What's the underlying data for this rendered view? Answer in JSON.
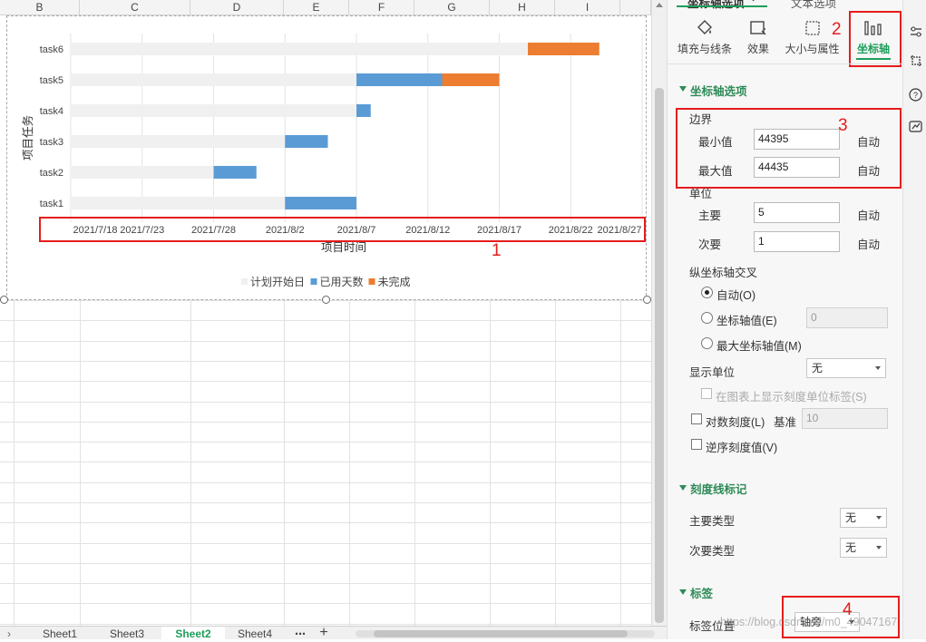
{
  "sheet": {
    "columns": [
      "B",
      "C",
      "D",
      "E",
      "F",
      "G",
      "H",
      "I"
    ],
    "tabs": [
      "Sheet1",
      "Sheet3",
      "Sheet2",
      "Sheet4"
    ],
    "active_tab": "Sheet2",
    "more_tabs_icon": "ellipsis-icon",
    "add_sheet_icon": "plus-icon"
  },
  "chart_data": {
    "type": "bar",
    "stacked": true,
    "orientation": "horizontal",
    "categories": [
      "task1",
      "task2",
      "task3",
      "task4",
      "task5",
      "task6"
    ],
    "series": [
      {
        "name": "计划开始日",
        "color": "#f0f0f0",
        "values": [
          44410,
          44405,
          44410,
          44415,
          44415,
          44427
        ]
      },
      {
        "name": "已用天数",
        "color": "#5b9bd5",
        "values": [
          5,
          3,
          3,
          1,
          6,
          0
        ]
      },
      {
        "name": "未完成",
        "color": "#ed7d31",
        "values": [
          0,
          0,
          0,
          0,
          4,
          5
        ]
      }
    ],
    "xlim": [
      44395,
      44435
    ],
    "x_ticks": [
      "2021/7/18",
      "2021/7/23",
      "2021/7/28",
      "2021/8/2",
      "2021/8/7",
      "2021/8/12",
      "2021/8/17",
      "2021/8/22",
      "2021/8/27"
    ],
    "xlabel": "项目时间",
    "ylabel": "项目任务",
    "legend": "bottom",
    "grid": true
  },
  "annotations": [
    "1",
    "2",
    "3",
    "4"
  ],
  "pane": {
    "top_tabs": [
      "坐标轴选项",
      "文本选项"
    ],
    "tab_dropdown_icon": "chevron-down-icon",
    "icon_tabs": [
      {
        "label": "填充与线条",
        "icon": "fill-bucket-icon"
      },
      {
        "label": "效果",
        "icon": "effects-icon"
      },
      {
        "label": "大小与属性",
        "icon": "size-properties-icon"
      },
      {
        "label": "坐标轴",
        "icon": "axis-bars-icon"
      }
    ],
    "axis_options_title": "坐标轴选项",
    "bounds": {
      "title": "边界",
      "min_label": "最小值",
      "min_value": "44395",
      "min_auto": "自动",
      "max_label": "最大值",
      "max_value": "44435",
      "max_auto": "自动"
    },
    "units": {
      "title": "单位",
      "major_label": "主要",
      "major_value": "5",
      "major_auto": "自动",
      "minor_label": "次要",
      "minor_value": "1",
      "minor_auto": "自动"
    },
    "cross": {
      "title": "纵坐标轴交叉",
      "auto": "自动(O)",
      "axis_value": "坐标轴值(E)",
      "axis_value_input": "0",
      "max_value": "最大坐标轴值(M)"
    },
    "display_units": {
      "label": "显示单位",
      "value": "无",
      "show_label": "在图表上显示刻度单位标签(S)"
    },
    "log_scale": {
      "label": "对数刻度(L)",
      "base_label": "基准",
      "base_value": "10"
    },
    "reverse": {
      "label": "逆序刻度值(V)"
    },
    "tick_marks": {
      "title": "刻度线标记",
      "major_label": "主要类型",
      "major_value": "无",
      "minor_label": "次要类型",
      "minor_value": "无"
    },
    "labels": {
      "title": "标签",
      "position_label": "标签位置",
      "position_value": "轴旁"
    },
    "watermark": "https://blog.csdn.net/m0_49047167"
  },
  "sidebar_icons": [
    "settings-sliders-icon",
    "crop-icon",
    "help-icon",
    "chart-icon"
  ]
}
